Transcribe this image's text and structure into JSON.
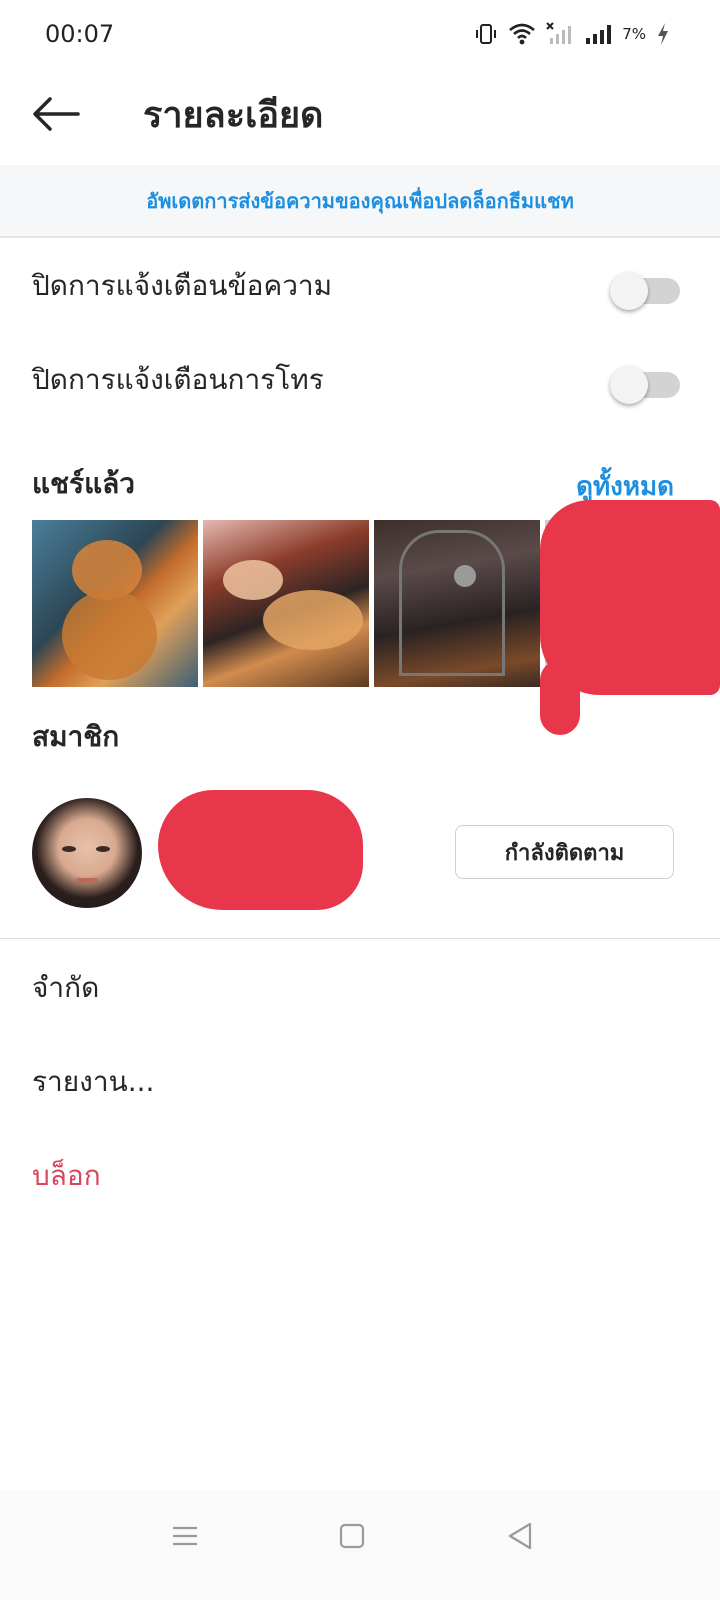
{
  "status_bar": {
    "time": "00:07",
    "battery": "7%",
    "icons": [
      "vibrate-icon",
      "wifi-icon",
      "signal-off-icon",
      "signal-icon",
      "charging-icon"
    ]
  },
  "header": {
    "title": "รายละเอียด",
    "back_icon": "arrow-left-icon"
  },
  "banner": {
    "text": "อัพเดตการส่งข้อความของคุณเพื่อปลดล็อกธีมแชท"
  },
  "settings": [
    {
      "label": "ปิดการแจ้งเตือนข้อความ",
      "enabled": false
    },
    {
      "label": "ปิดการแจ้งเตือนการโทร",
      "enabled": false
    }
  ],
  "shared": {
    "title": "แชร์แล้ว",
    "see_all": "ดูทั้งหมด",
    "thumbnails": [
      "cat-photo-1",
      "cat-photo-2",
      "bag-photo",
      "redacted-photo"
    ]
  },
  "members": {
    "title": "สมาชิก",
    "follow_label": "กำลังติดตาม"
  },
  "actions": {
    "restrict": "จำกัด",
    "report": "รายงาน...",
    "block": "บล็อก"
  },
  "colors": {
    "accent": "#1d8fe0",
    "danger": "#d9455f",
    "redaction": "#e8364a"
  },
  "nav_bar": {
    "icons": [
      "menu-icon",
      "home-square-icon",
      "back-triangle-icon"
    ]
  }
}
